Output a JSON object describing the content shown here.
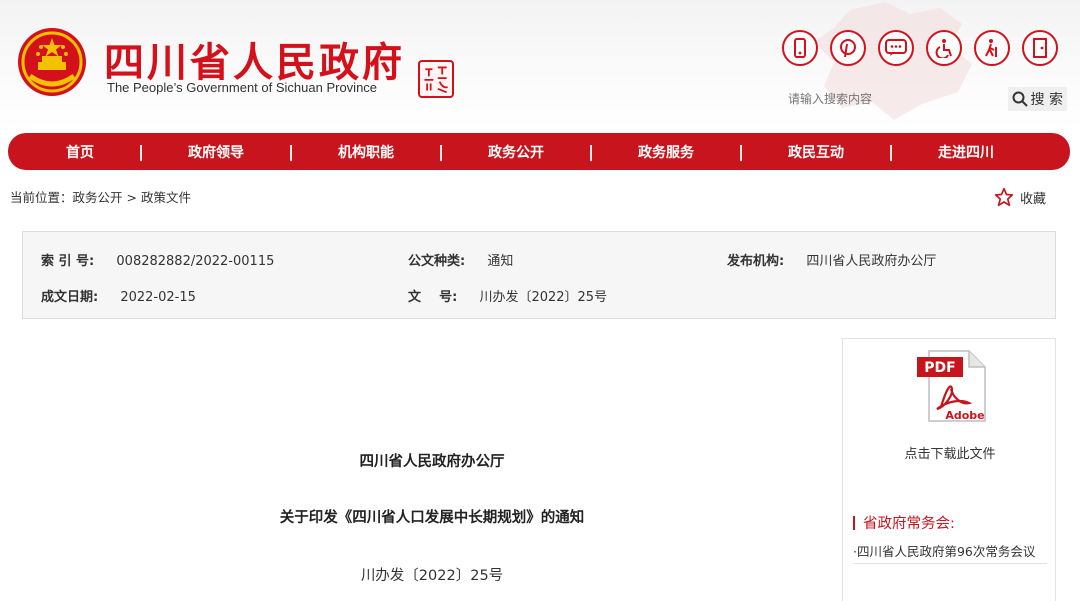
{
  "header": {
    "logo_cn": "四川省人民政府",
    "logo_en": "The People’s Government of Sichuan Province",
    "tools": [
      {
        "name": "mobile-icon"
      },
      {
        "name": "pinterest-icon"
      },
      {
        "name": "message-icon"
      },
      {
        "name": "accessibility-icon"
      },
      {
        "name": "elderly-icon"
      },
      {
        "name": "exit-icon"
      }
    ],
    "search": {
      "placeholder": "请输入搜索内容",
      "button_label": "搜 索"
    }
  },
  "nav": {
    "items": [
      "首页",
      "政府领导",
      "机构职能",
      "政务公开",
      "政务服务",
      "政民互动",
      "走进四川"
    ],
    "separator": "|"
  },
  "breadcrumb": {
    "prefix": "当前位置：",
    "items": [
      "政务公开",
      "政策文件"
    ],
    "separator": " > "
  },
  "favorite": {
    "label": "收藏"
  },
  "meta": {
    "index_label": "索 引 号:",
    "index_value": "008282882/2022-00115",
    "type_label": "公文种类:",
    "type_value": "通知",
    "issuer_label": "发布机构:",
    "issuer_value": "四川省人民政府办公厅",
    "date_label": "成文日期:",
    "date_value": "2022-02-15",
    "docno_label": "文    号:",
    "docno_value": "川办发〔2022〕25号"
  },
  "document": {
    "org": "四川省人民政府办公厅",
    "title": "关于印发《四川省人口发展中长期规划》的通知",
    "number": "川办发〔2022〕25号"
  },
  "sidebar": {
    "pdf_badge": "PDF",
    "pdf_brand": "Adobe",
    "download_label": "点击下载此文件",
    "section_title": "省政府常务会:",
    "links": [
      "·四川省人民政府第96次常务会议"
    ]
  },
  "colors": {
    "brand": "#c8151d",
    "meta_bg": "#f6f6f6"
  }
}
